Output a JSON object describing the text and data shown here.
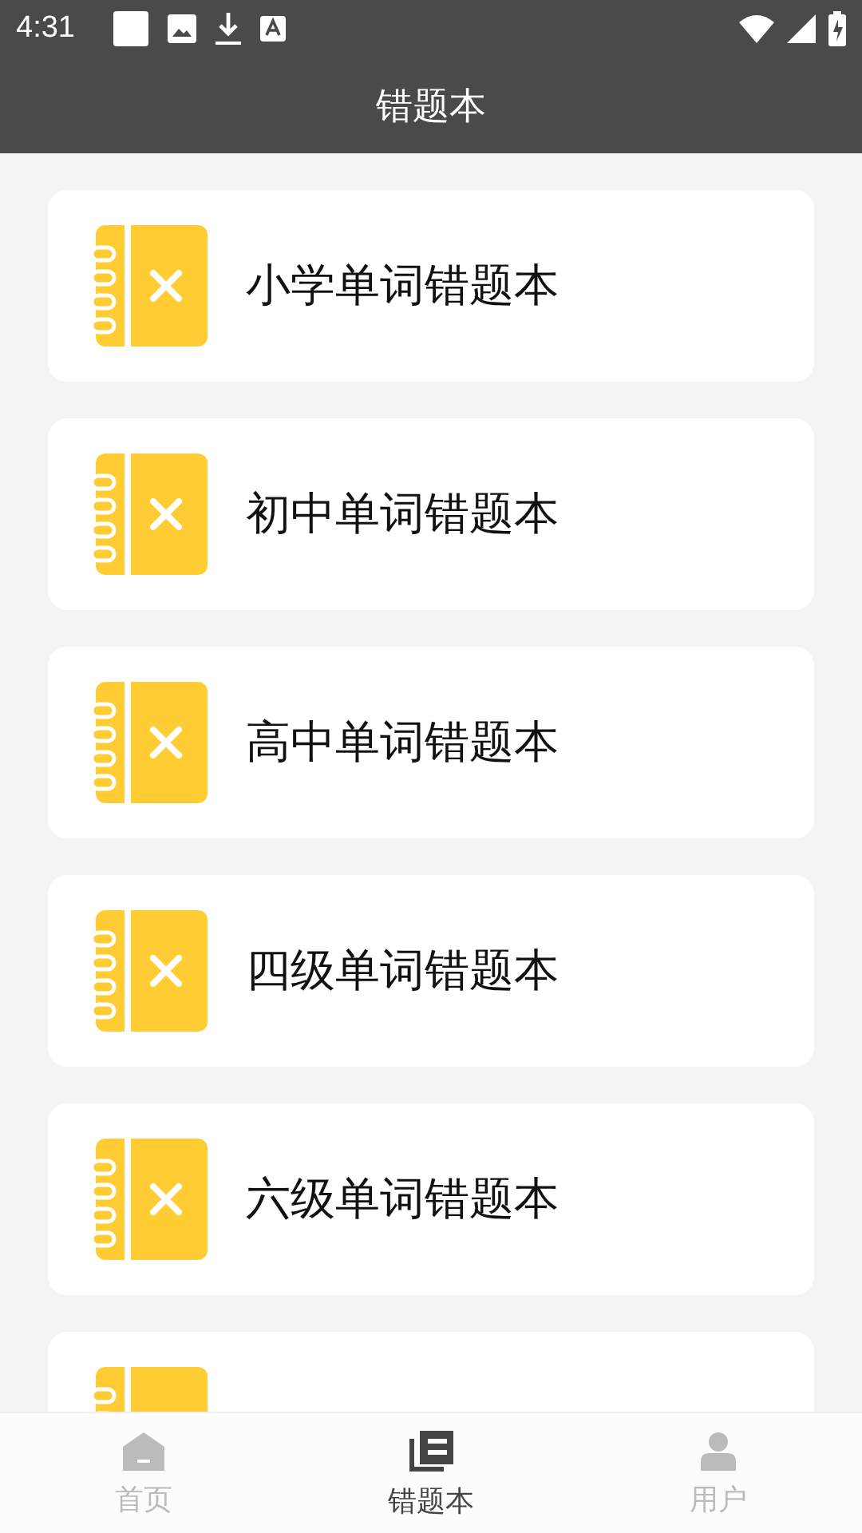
{
  "status_bar": {
    "time": "4:31"
  },
  "title": "错题本",
  "books": [
    {
      "label": "小学单词错题本"
    },
    {
      "label": "初中单词错题本"
    },
    {
      "label": "高中单词错题本"
    },
    {
      "label": "四级单词错题本"
    },
    {
      "label": "六级单词错题本"
    }
  ],
  "next_card_partly_hidden": true,
  "nav": [
    {
      "label": "首页",
      "selected": false
    },
    {
      "label": "错题本",
      "selected": true
    },
    {
      "label": "用户",
      "selected": false
    }
  ]
}
